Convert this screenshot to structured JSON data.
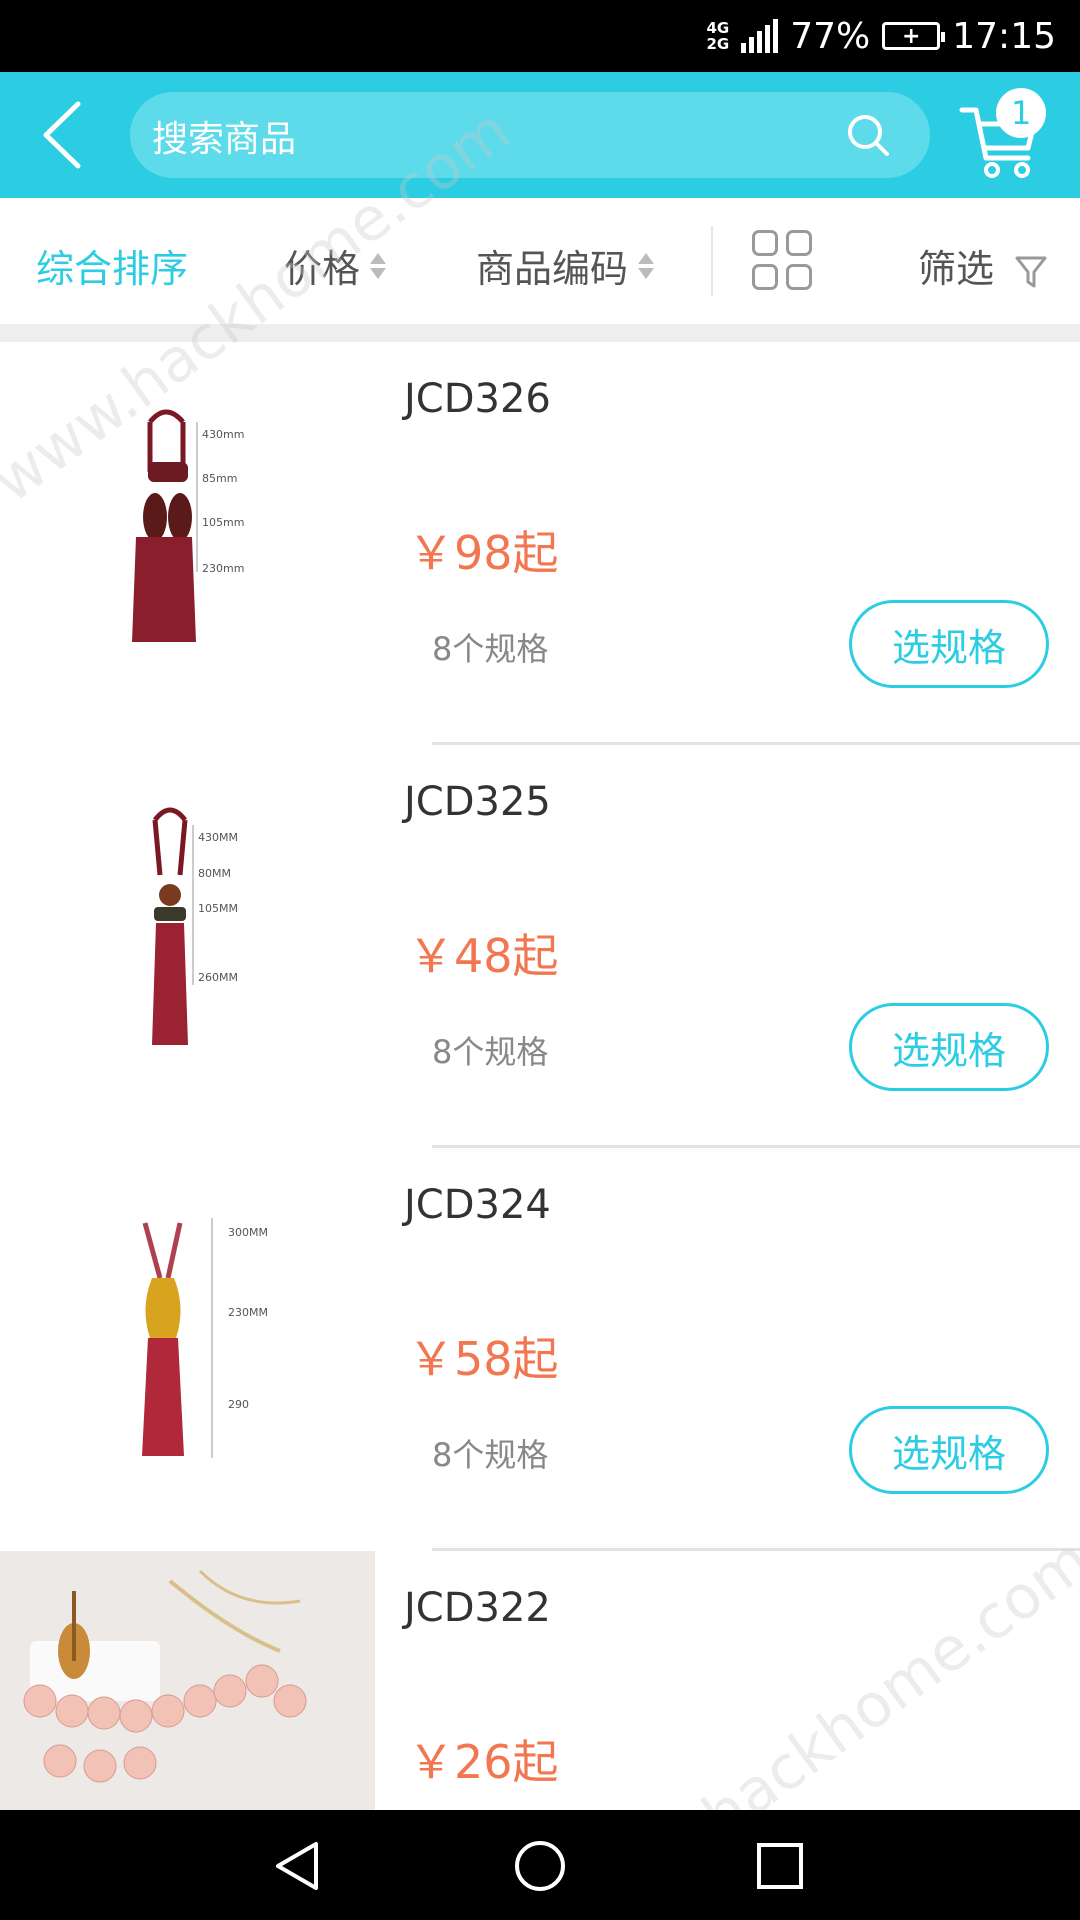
{
  "status_bar": {
    "network_top": "4G",
    "network_bottom": "2G",
    "battery_percent": "77%",
    "time": "17:15"
  },
  "header": {
    "search_placeholder": "搜索商品",
    "cart_count": "1"
  },
  "sort_bar": {
    "items": [
      {
        "label": "综合排序",
        "active": true
      },
      {
        "label": "价格",
        "active": false
      },
      {
        "label": "商品编码",
        "active": false
      }
    ],
    "filter_label": "筛选"
  },
  "products": [
    {
      "code": "JCD326",
      "price": "￥98起",
      "specs": "8个规格",
      "button": "选规格",
      "dims": [
        "430mm",
        "85mm",
        "105mm",
        "230mm"
      ]
    },
    {
      "code": "JCD325",
      "price": "￥48起",
      "specs": "8个规格",
      "button": "选规格",
      "dims": [
        "430MM",
        "80MM",
        "105MM",
        "260MM"
      ]
    },
    {
      "code": "JCD324",
      "price": "￥58起",
      "specs": "8个规格",
      "button": "选规格",
      "dims": [
        "300MM",
        "230MM",
        "290"
      ]
    },
    {
      "code": "JCD322",
      "price": "￥26起",
      "specs": "",
      "button": "",
      "dims": []
    }
  ],
  "watermark": "www.hackhome.com",
  "colors": {
    "accent": "#2ccde3",
    "price": "#f27751"
  }
}
